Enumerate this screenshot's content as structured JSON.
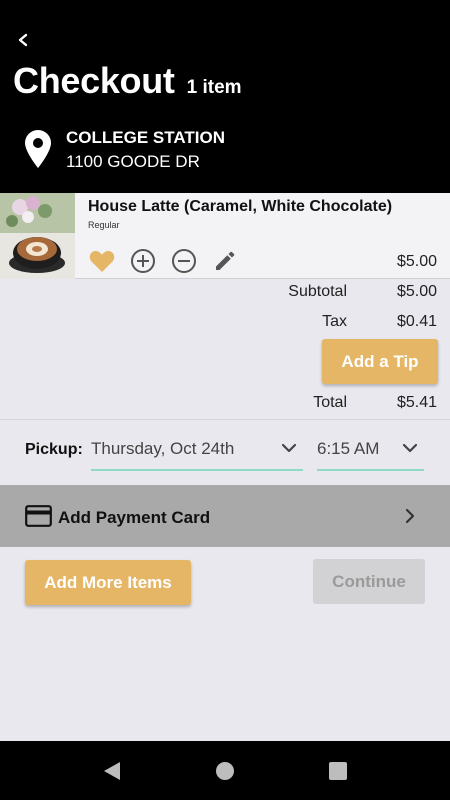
{
  "header": {
    "title": "Checkout",
    "item_count": "1 item",
    "location_name": "COLLEGE STATION",
    "location_address": "1100 GOODE DR"
  },
  "cart": {
    "items": [
      {
        "name": "House Latte (Caramel, White Chocolate)",
        "modifier": "Regular",
        "price": "$5.00"
      }
    ]
  },
  "totals": {
    "subtotal_label": "Subtotal",
    "subtotal_value": "$5.00",
    "tax_label": "Tax",
    "tax_value": "$0.41",
    "tip_button": "Add a Tip",
    "total_label": "Total",
    "total_value": "$5.41"
  },
  "pickup": {
    "label": "Pickup:",
    "date": "Thursday, Oct 24th",
    "time": "6:15 AM"
  },
  "payment": {
    "label": "Add Payment Card"
  },
  "actions": {
    "add_more": "Add More Items",
    "continue": "Continue"
  },
  "colors": {
    "accent": "#e4b665",
    "underline": "#8fd9c6",
    "header_bg": "#000000",
    "disabled_bg": "#d2d2d4"
  },
  "icons": [
    "back-arrow-icon",
    "location-pin-icon",
    "heart-icon",
    "plus-circle-icon",
    "minus-circle-icon",
    "pencil-icon",
    "chevron-down-icon",
    "credit-card-icon",
    "chevron-right-icon",
    "nav-back-icon",
    "nav-home-icon",
    "nav-recents-icon"
  ]
}
